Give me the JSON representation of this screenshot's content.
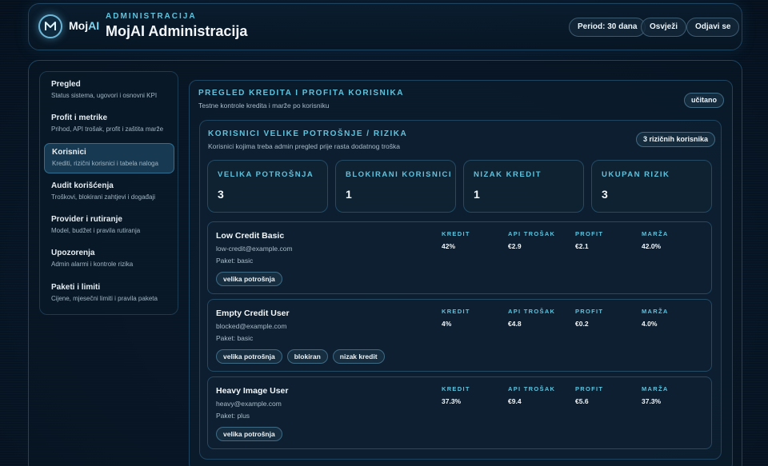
{
  "header": {
    "logo_text_main": "Moj",
    "logo_text_accent": "AI",
    "eyebrow": "ADMINISTRACIJA",
    "title": "MojAI Administracija",
    "period_label": "Period: 30 dana",
    "refresh_label": "Osvježi",
    "logout_label": "Odjavi se"
  },
  "nav": {
    "items": [
      {
        "label": "Pregled",
        "sub": "Status sistema, ugovori i osnovni KPI"
      },
      {
        "label": "Profit i metrike",
        "sub": "Prihod, API trošak, profit i zaštita marže"
      },
      {
        "label": "Korisnici",
        "sub": "Krediti, rizični korisnici i tabela naloga"
      },
      {
        "label": "Audit korišćenja",
        "sub": "Troškovi, blokirani zahtjevi i događaji"
      },
      {
        "label": "Provider i rutiranje",
        "sub": "Model, budžet i pravila rutiranja"
      },
      {
        "label": "Upozorenja",
        "sub": "Admin alarmi i kontrole rizika"
      },
      {
        "label": "Paketi i limiti",
        "sub": "Cijene, mjesečni limiti i pravila paketa"
      }
    ],
    "active_index": 2
  },
  "overview": {
    "title": "PREGLED KREDITA I PROFITA KORISNIKA",
    "subtitle": "Testne kontrole kredita i marže po korisniku",
    "status": "učitano"
  },
  "risk": {
    "title": "KORISNICI VELIKE POTROŠNJE / RIZIKA",
    "subtitle": "Korisnici kojima treba admin pregled prije rasta dodatnog troška",
    "badge": "3 rizičnih korisnika",
    "stats": [
      {
        "label": "VELIKA POTROŠNJA",
        "value": "3"
      },
      {
        "label": "BLOKIRANI KORISNICI",
        "value": "1"
      },
      {
        "label": "NIZAK KREDIT",
        "value": "1"
      },
      {
        "label": "UKUPAN RIZIK",
        "value": "3"
      }
    ],
    "metric_labels": [
      "KREDIT",
      "API TROŠAK",
      "PROFIT",
      "MARŽA"
    ],
    "users": [
      {
        "name": "Low Credit Basic",
        "email": "low-credit@example.com",
        "plan": "Paket: basic",
        "tags": [
          "velika potrošnja"
        ],
        "metrics": [
          "42%",
          "€2.9",
          "€2.1",
          "42.0%"
        ]
      },
      {
        "name": "Empty Credit User",
        "email": "blocked@example.com",
        "plan": "Paket: basic",
        "tags": [
          "velika potrošnja",
          "blokiran",
          "nizak kredit"
        ],
        "metrics": [
          "4%",
          "€4.8",
          "€0.2",
          "4.0%"
        ]
      },
      {
        "name": "Heavy Image User",
        "email": "heavy@example.com",
        "plan": "Paket: plus",
        "tags": [
          "velika potrošnja"
        ],
        "metrics": [
          "37.3%",
          "€9.4",
          "€5.6",
          "37.3%"
        ]
      }
    ]
  },
  "colors": {
    "accent": "#5fc3de",
    "background": "#071626",
    "active_nav": "#173a52"
  }
}
